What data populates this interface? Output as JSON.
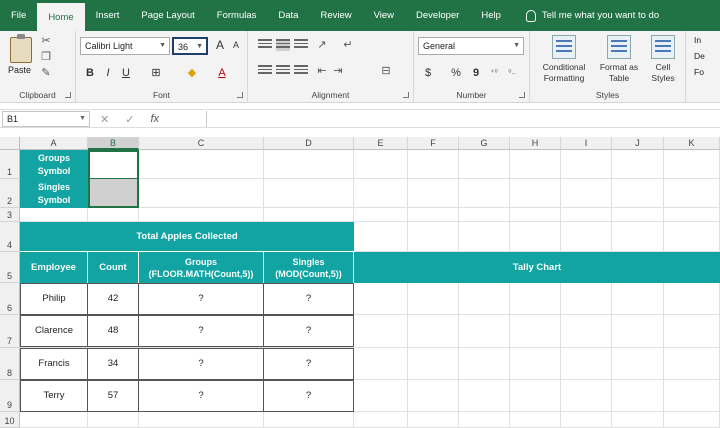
{
  "menu": {
    "tabs": [
      "File",
      "Home",
      "Insert",
      "Page Layout",
      "Formulas",
      "Data",
      "Review",
      "View",
      "Developer",
      "Help"
    ],
    "active": "Home",
    "tell_me": "Tell me what you want to do"
  },
  "ribbon": {
    "clipboard": {
      "label": "Clipboard",
      "paste": "Paste"
    },
    "font": {
      "label": "Font",
      "name": "Calibri Light",
      "size": "36",
      "bold": "B",
      "italic": "I",
      "underline": "U",
      "grow": "A",
      "shrink": "A",
      "font_color": "A"
    },
    "alignment": {
      "label": "Alignment"
    },
    "number": {
      "label": "Number",
      "format": "General",
      "currency": "$",
      "percent": "%",
      "comma": "9"
    },
    "styles": {
      "label": "Styles",
      "conditional": [
        "Conditional",
        "Formatting"
      ],
      "format_table": [
        "Format as",
        "Table"
      ],
      "cell_styles": [
        "Cell",
        "Styles"
      ]
    },
    "cells": {
      "items": [
        "In",
        "De",
        "Fo"
      ]
    }
  },
  "formula_bar": {
    "name_box": "B1",
    "cancel": "✕",
    "enter": "✓",
    "fx": "fx",
    "content": ""
  },
  "columns": [
    "A",
    "B",
    "C",
    "D",
    "E",
    "F",
    "G",
    "H",
    "I",
    "J",
    "K"
  ],
  "selected_column": "B",
  "rows": [
    "1",
    "2",
    "3",
    "4",
    "5",
    "6",
    "7",
    "8",
    "9",
    "10"
  ],
  "symbols": {
    "groups": [
      "Groups",
      "Symbol"
    ],
    "singles": [
      "Singles",
      "Symbol"
    ]
  },
  "table": {
    "title": "Total Apples Collected",
    "headers": {
      "employee": "Employee",
      "count": "Count",
      "groups": [
        "Groups",
        "(FLOOR.MATH(Count,5))"
      ],
      "singles": [
        "Singles",
        "(MOD(Count,5))"
      ],
      "tally": "Tally Chart"
    },
    "rows": [
      {
        "employee": "Philip",
        "count": "42",
        "groups": "?",
        "singles": "?"
      },
      {
        "employee": "Clarence",
        "count": "48",
        "groups": "?",
        "singles": "?"
      },
      {
        "employee": "Francis",
        "count": "34",
        "groups": "?",
        "singles": "?"
      },
      {
        "employee": "Terry",
        "count": "57",
        "groups": "?",
        "singles": "?"
      }
    ]
  },
  "colors": {
    "excel_green": "#217346",
    "teal": "#12a3a3"
  }
}
